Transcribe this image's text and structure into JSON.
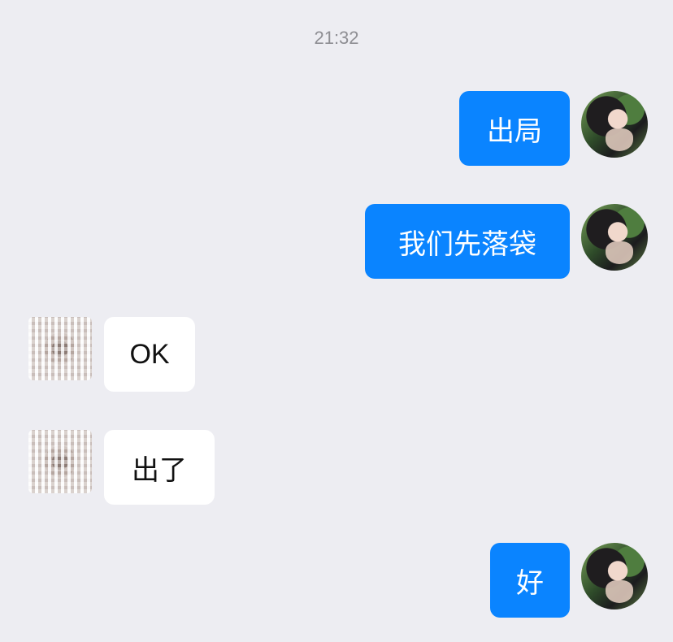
{
  "chat": {
    "timestamp": "21:32",
    "messages": [
      {
        "sender": "self",
        "text": "出局"
      },
      {
        "sender": "self",
        "text": "我们先落袋"
      },
      {
        "sender": "other",
        "text": "OK"
      },
      {
        "sender": "other",
        "text": "出了"
      },
      {
        "sender": "self",
        "text": "好"
      }
    ]
  },
  "colors": {
    "background": "#ededf2",
    "self_bubble": "#0a84ff",
    "other_bubble": "#ffffff",
    "timestamp_text": "#8e8e93"
  }
}
